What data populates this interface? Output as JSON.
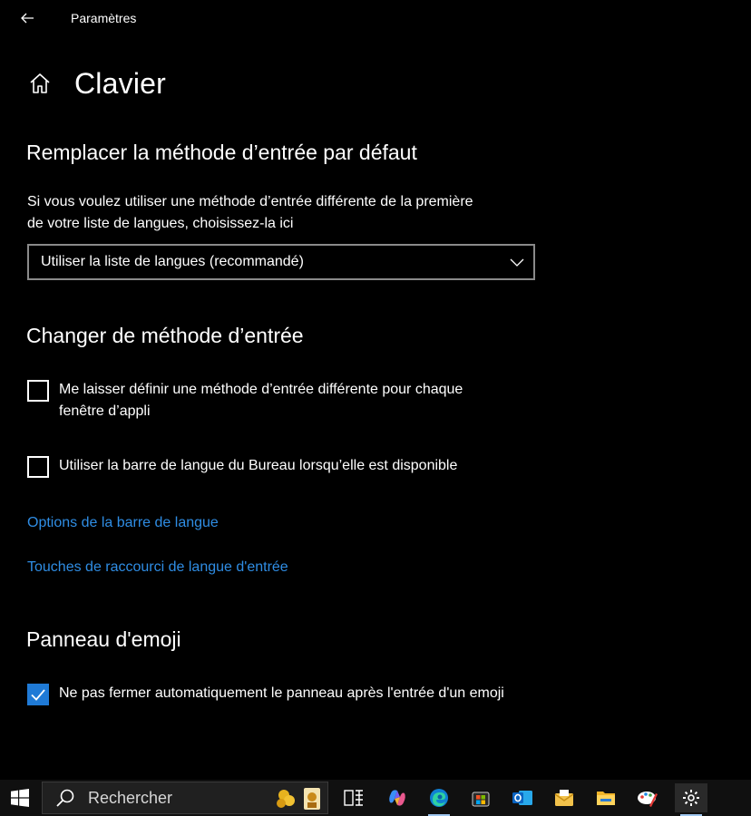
{
  "window": {
    "title": "Paramètres"
  },
  "page": {
    "title": "Clavier"
  },
  "sections": {
    "default_method": {
      "title": "Remplacer la méthode d’entrée par défaut",
      "description_line1": "Si vous voulez utiliser une méthode d’entrée différente de la première",
      "description_line2": "de votre liste de langues, choisissez-la ici",
      "dropdown_value": "Utiliser la liste de langues (recommandé)"
    },
    "switch_method": {
      "title": "Changer de méthode d’entrée",
      "checkbox1_line1": "Me laisser définir une méthode d’entrée différente pour chaque",
      "checkbox1_line2": "fenêtre d’appli",
      "checkbox1_checked": false,
      "checkbox2": "Utiliser la barre de langue du Bureau lorsqu’elle est disponible",
      "checkbox2_checked": false,
      "link1": "Options de la barre de langue",
      "link2": "Touches de raccourci de langue d'entrée"
    },
    "emoji": {
      "title": "Panneau d'emoji",
      "checkbox": "Ne pas fermer automatiquement le panneau après l'entrée d'un emoji",
      "checkbox_checked": true
    }
  },
  "taskbar": {
    "search_placeholder": "Rechercher",
    "icons": [
      "windows-start-icon",
      "task-view-icon",
      "copilot-icon",
      "edge-icon",
      "store-icon",
      "outlook-icon",
      "mail-envelope-icon",
      "file-explorer-icon",
      "paint-icon",
      "settings-icon"
    ]
  },
  "colors": {
    "accent": "#1f7ad6",
    "link": "#2f8de4",
    "background": "#000000"
  }
}
